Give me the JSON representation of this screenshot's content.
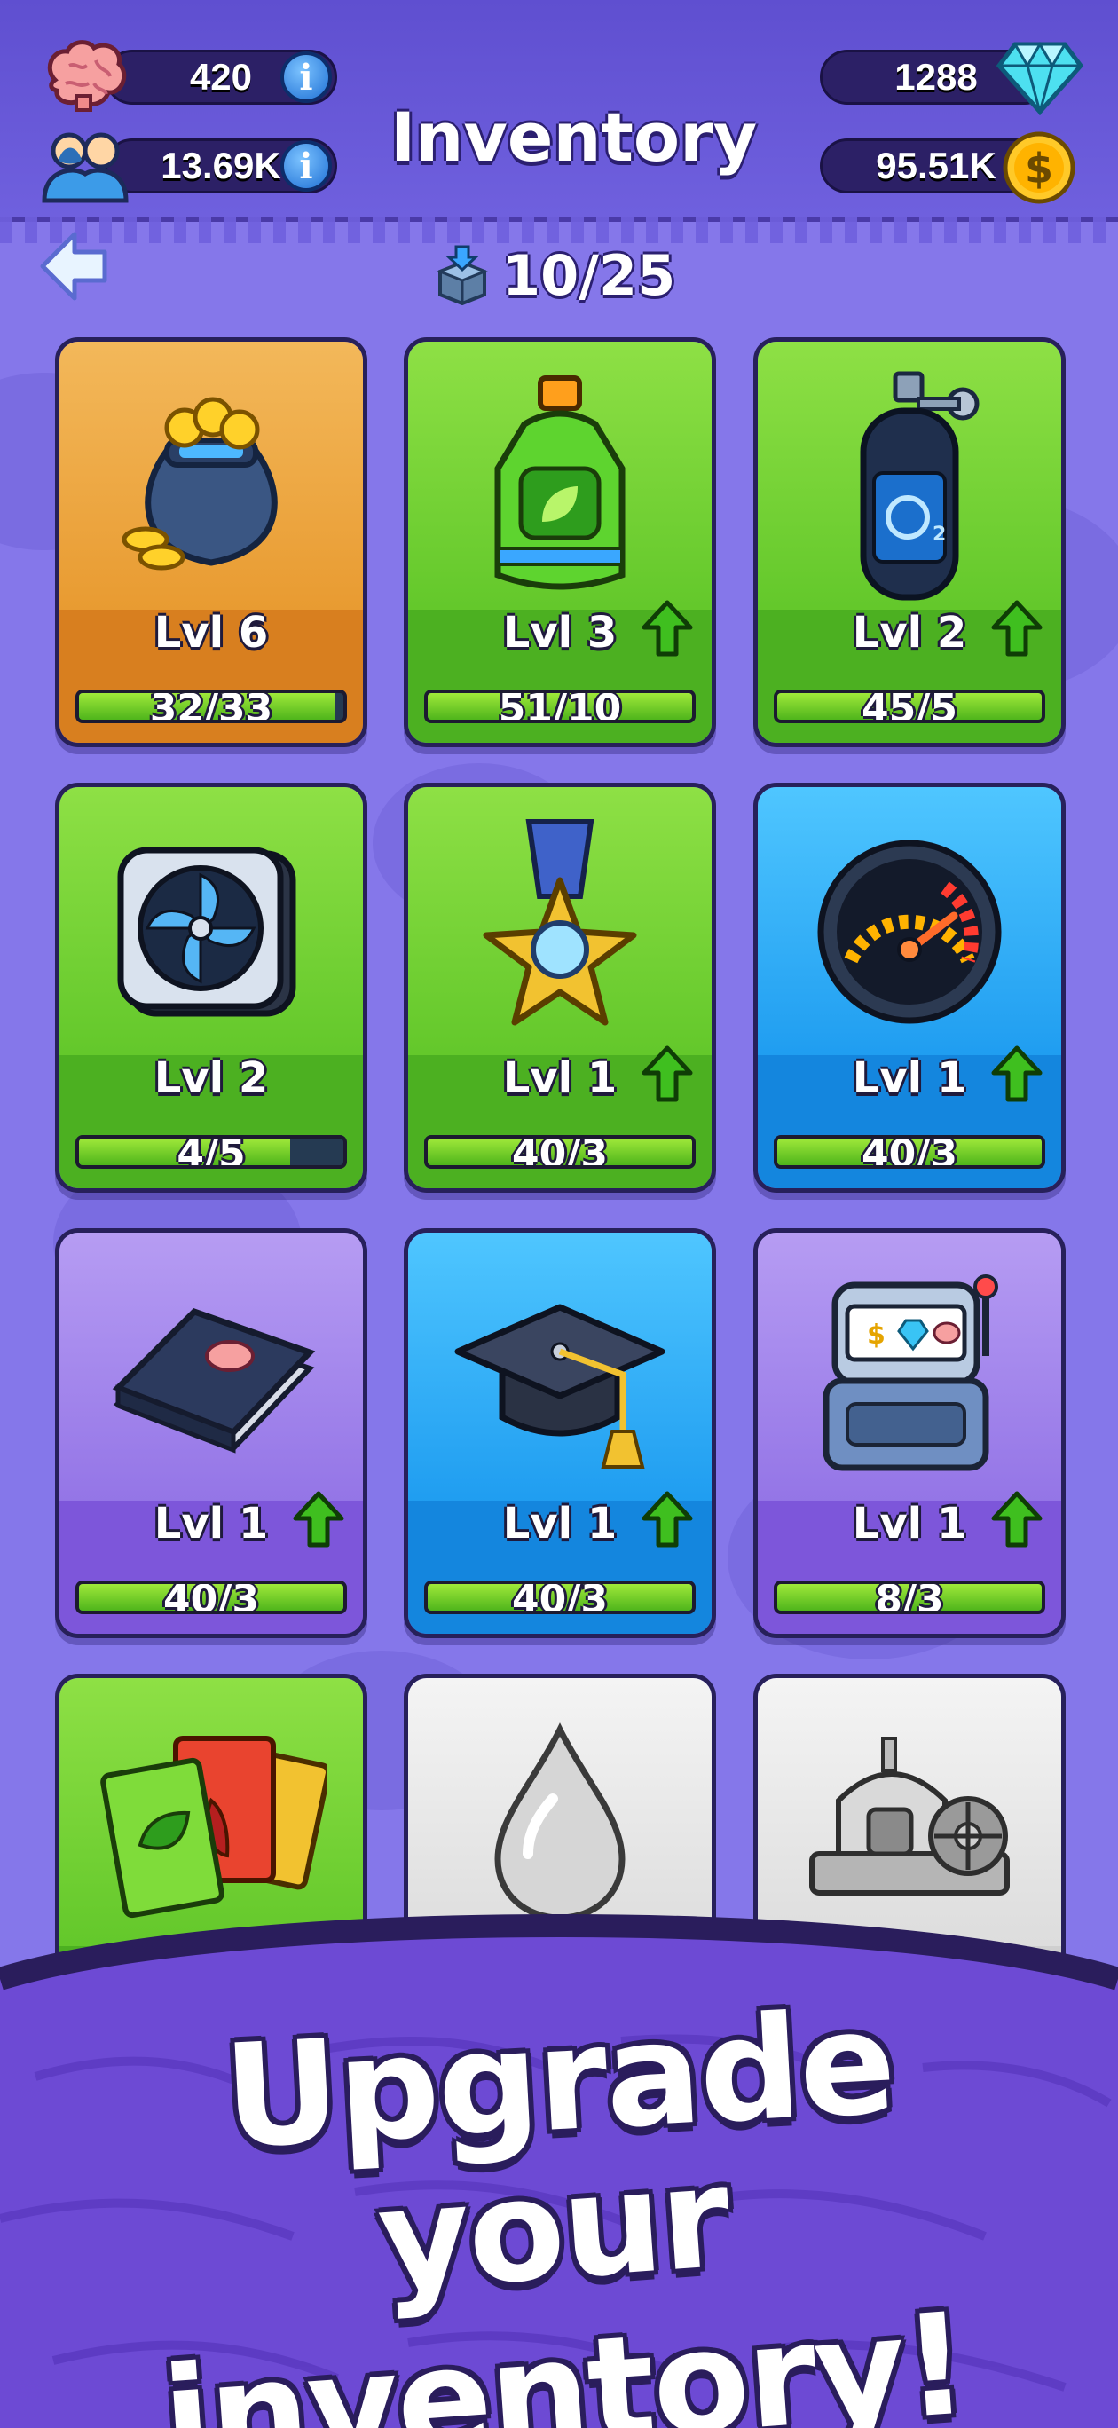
{
  "header": {
    "title": "Inventory",
    "brain_value": "420",
    "followers_value": "13.69K",
    "gems_value": "1288",
    "coins_value": "95.51K",
    "info_label": "i"
  },
  "capacity": {
    "text": "10/25"
  },
  "items": [
    {
      "name": "coin-sack",
      "level": "Lvl 6",
      "progress_text": "32/33",
      "progress": 0.97,
      "color": "orange",
      "upgradable": false
    },
    {
      "name": "fertilizer-bottle",
      "level": "Lvl 3",
      "progress_text": "51/10",
      "progress": 1.0,
      "color": "green",
      "upgradable": true
    },
    {
      "name": "oxygen-tank",
      "level": "Lvl 2",
      "progress_text": "45/5",
      "progress": 1.0,
      "color": "green",
      "upgradable": true
    },
    {
      "name": "cooling-fan",
      "level": "Lvl 2",
      "progress_text": "4/5",
      "progress": 0.8,
      "color": "green",
      "upgradable": false
    },
    {
      "name": "star-medal",
      "level": "Lvl 1",
      "progress_text": "40/3",
      "progress": 1.0,
      "color": "green",
      "upgradable": true
    },
    {
      "name": "speedometer",
      "level": "Lvl 1",
      "progress_text": "40/3",
      "progress": 1.0,
      "color": "blue",
      "upgradable": true
    },
    {
      "name": "brain-book",
      "level": "Lvl 1",
      "progress_text": "40/3",
      "progress": 1.0,
      "color": "purple",
      "upgradable": true
    },
    {
      "name": "graduation-cap",
      "level": "Lvl 1",
      "progress_text": "40/3",
      "progress": 1.0,
      "color": "blue",
      "upgradable": true
    },
    {
      "name": "slot-machine",
      "level": "Lvl 1",
      "progress_text": "8/3",
      "progress": 1.0,
      "color": "purple",
      "upgradable": true
    },
    {
      "name": "seed-packets",
      "color": "green"
    },
    {
      "name": "water-drop",
      "color": "grey"
    },
    {
      "name": "generator-machine",
      "color": "grey"
    }
  ],
  "promo": {
    "line1": "Upgrade",
    "line2": "your inventory!"
  },
  "colors": {
    "background": "#8577ea",
    "header": "#5f4fd0",
    "progress_fill": "#62c72a",
    "upgrade_arrow": "#3fbf1f",
    "banner": "#6d4ad4"
  }
}
